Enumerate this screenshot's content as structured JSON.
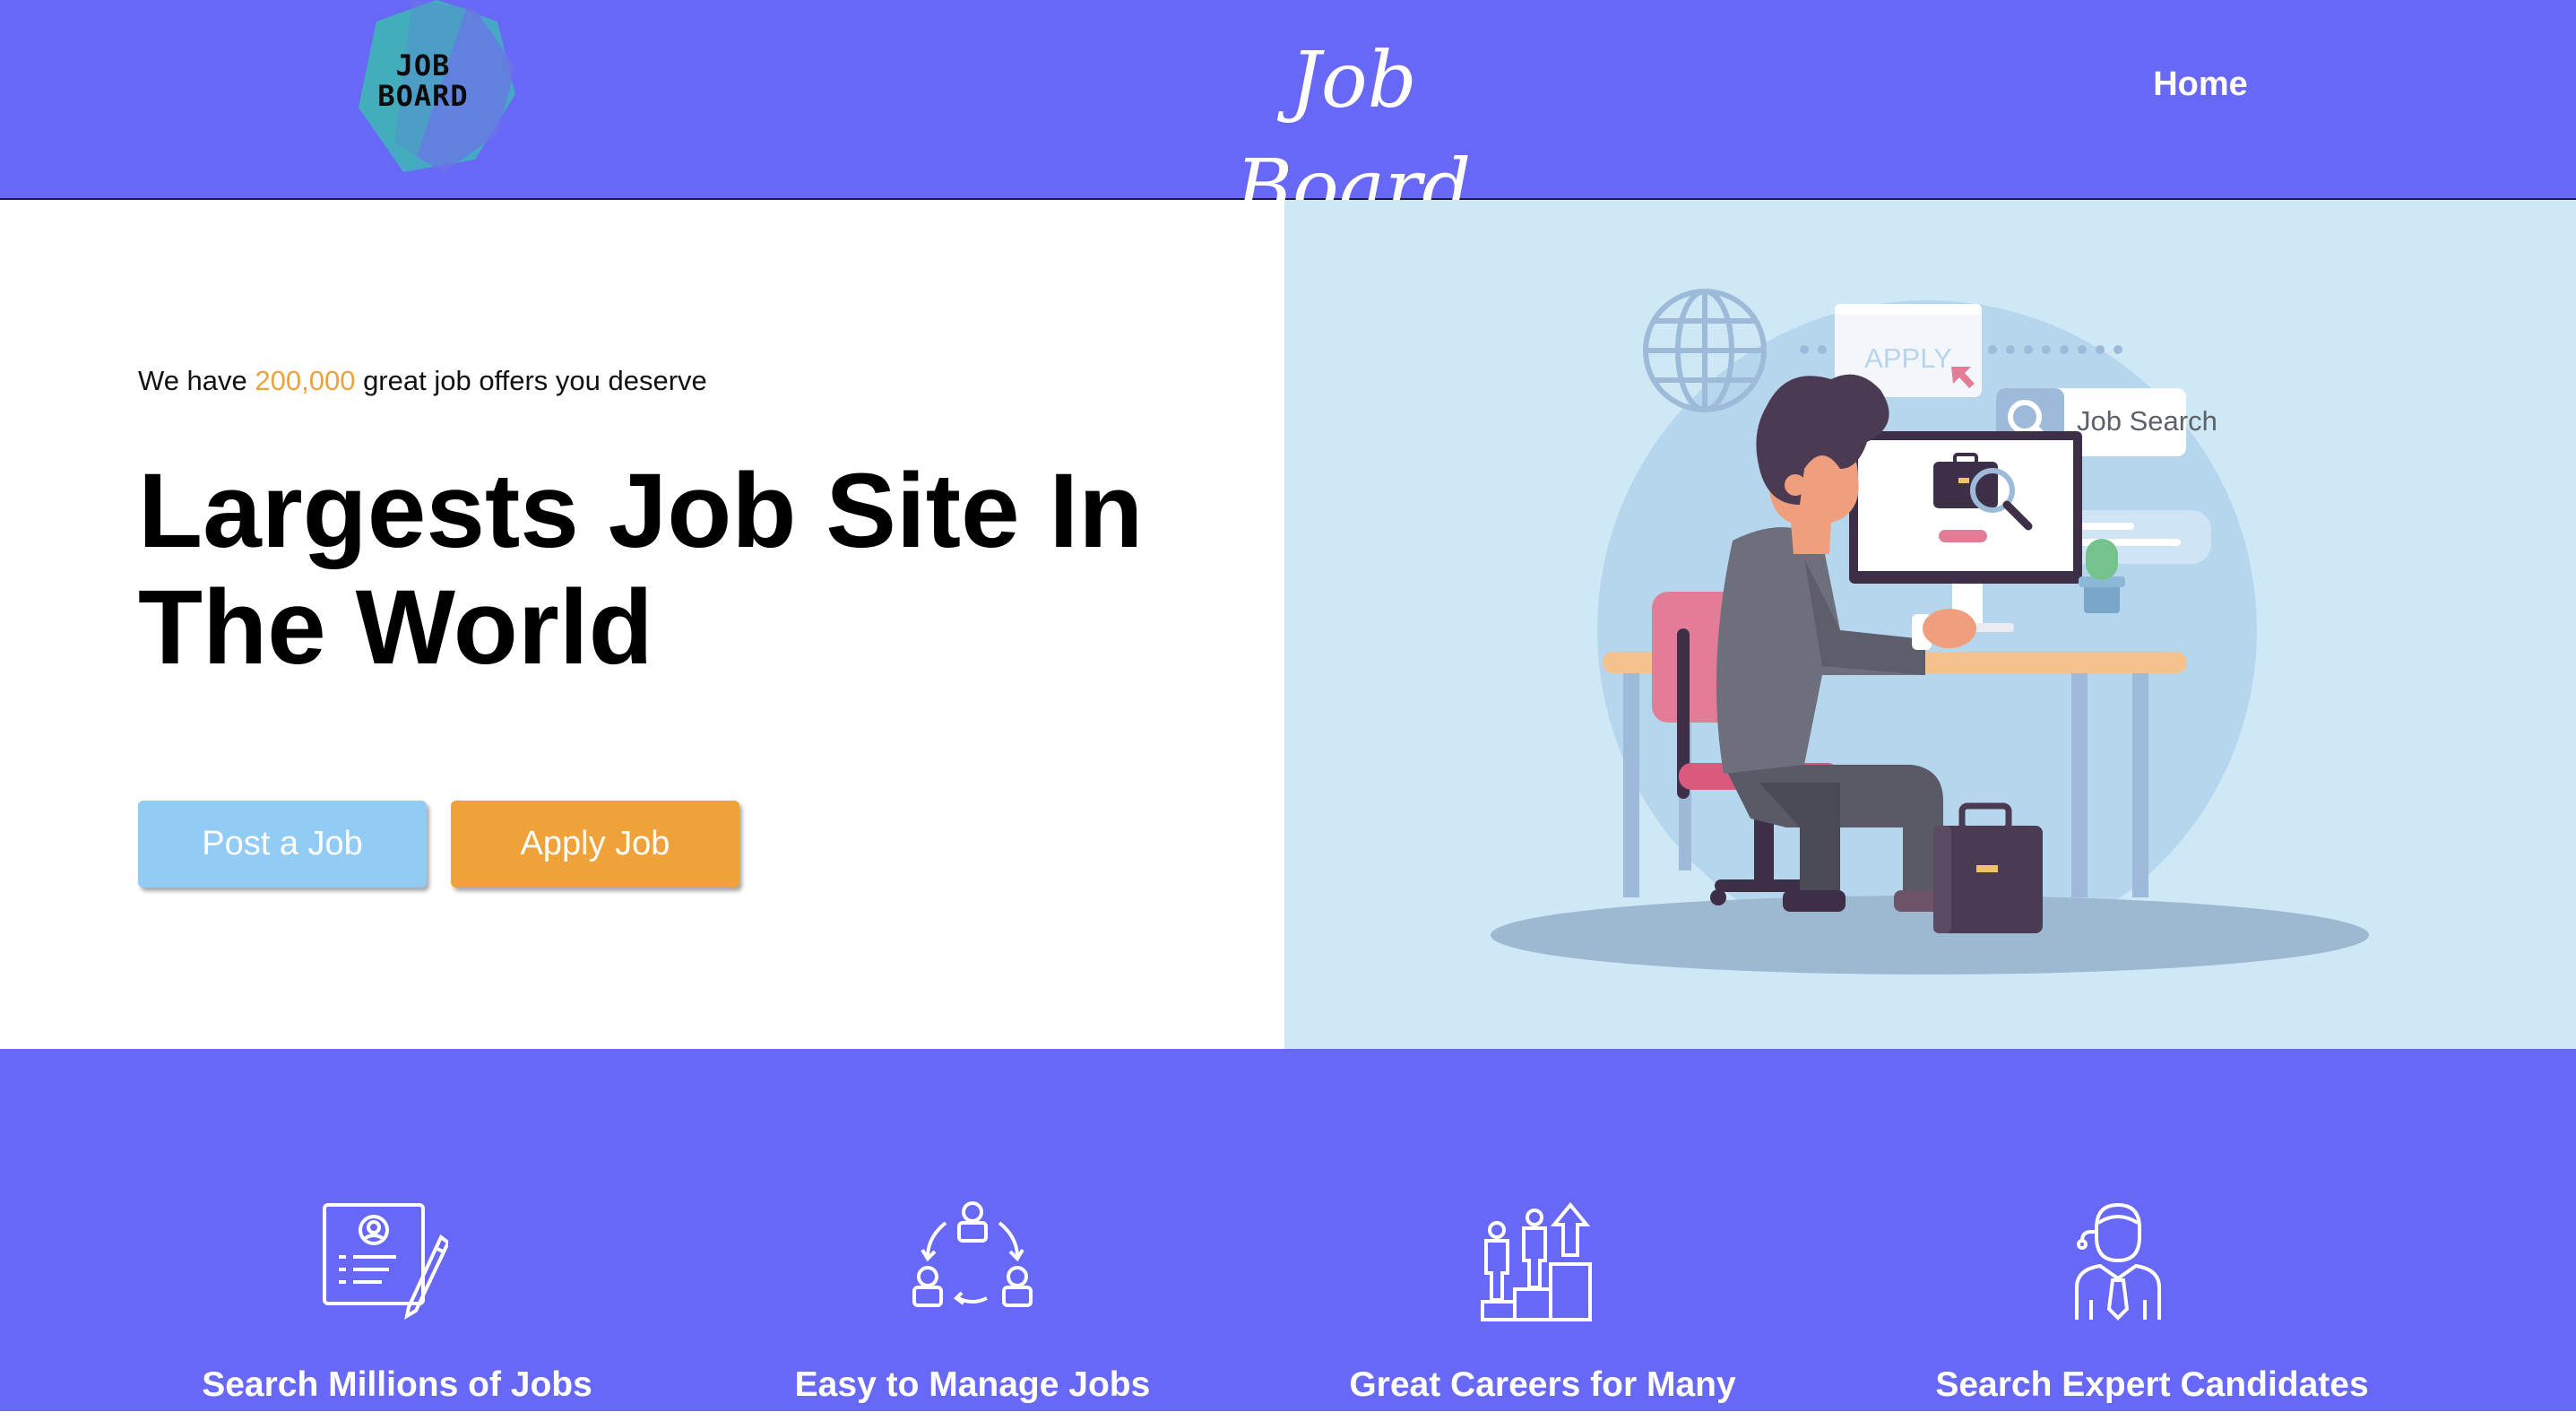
{
  "header": {
    "logo": {
      "line1": "JOB",
      "line2": "BOARD"
    },
    "title": "Job Board",
    "nav": [
      {
        "label": "Home"
      }
    ]
  },
  "hero": {
    "tagline_before": "We have ",
    "tagline_count": "200,000",
    "tagline_after": " great job offers you deserve",
    "headline_line1": "Largests Job Site In",
    "headline_line2": "The World",
    "buttons": {
      "post": "Post a Job",
      "apply": "Apply Job"
    },
    "illustration": {
      "apply_label": "APPLY",
      "search_label": "Job Search"
    }
  },
  "features": [
    {
      "label": "Search Millions of Jobs",
      "icon": "resume-icon"
    },
    {
      "label": "Easy to Manage Jobs",
      "icon": "team-cycle-icon"
    },
    {
      "label": "Great Careers for Many",
      "icon": "career-growth-icon"
    },
    {
      "label": "Search Expert Candidates",
      "icon": "candidate-icon"
    }
  ],
  "colors": {
    "brand": "#6868f6",
    "accent": "#f0a23a",
    "secondary": "#92cbf3",
    "hero_panel": "#cfe8f6"
  }
}
